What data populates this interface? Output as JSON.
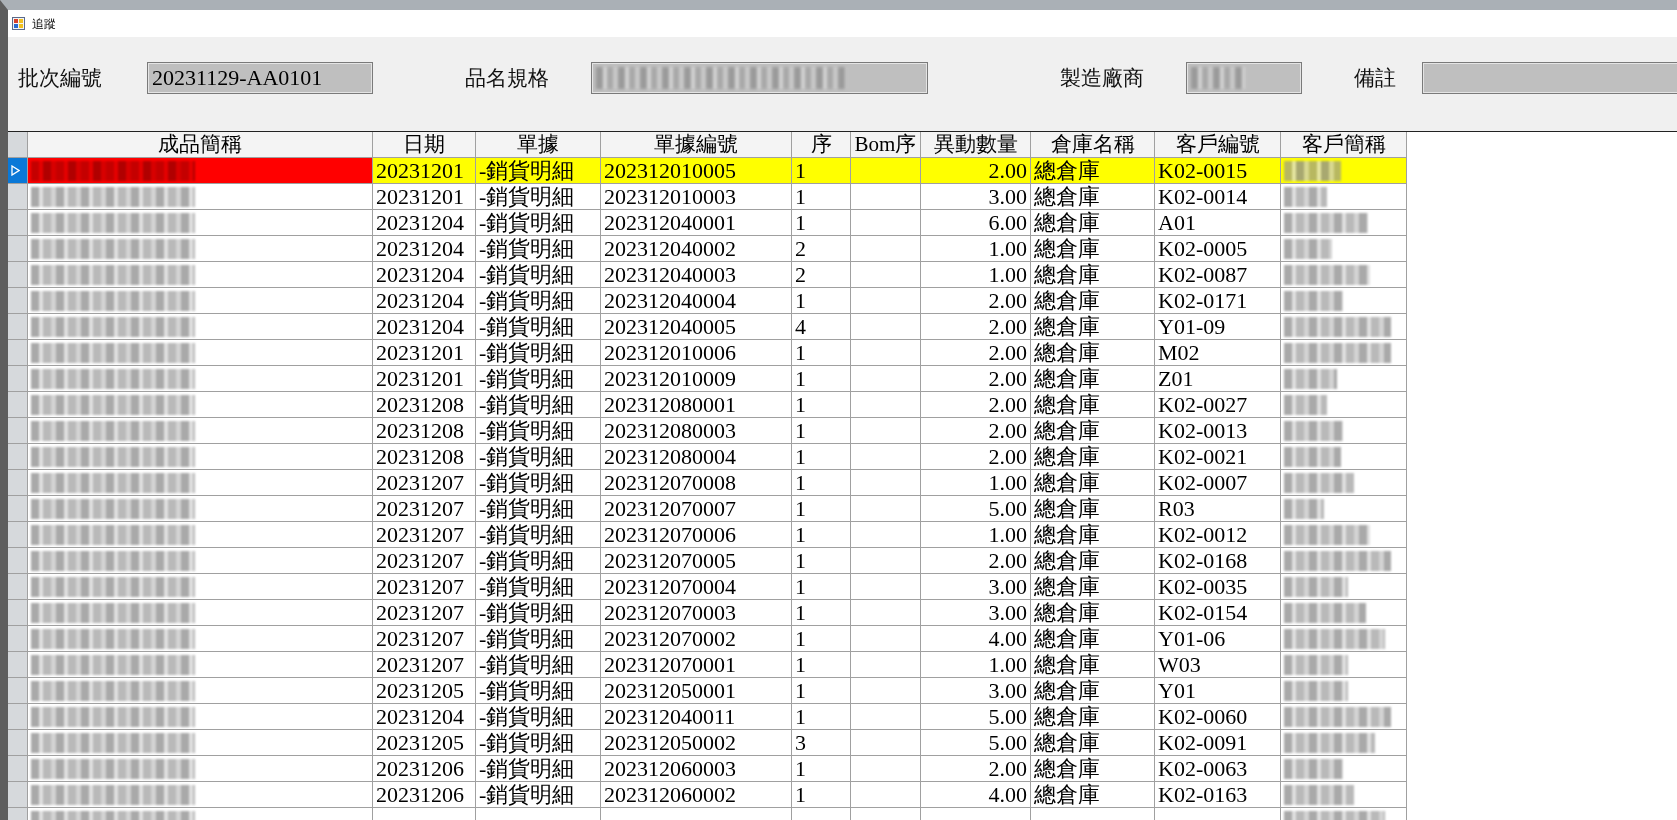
{
  "window": {
    "title": "追蹤"
  },
  "fields": [
    {
      "label": "批次編號",
      "value": "20231129-AA0101",
      "blurred": false
    },
    {
      "label": "品名規格",
      "blurred": true
    },
    {
      "label": "製造廠商",
      "blurred": true
    },
    {
      "label": "備註",
      "blurred": false
    }
  ],
  "table": {
    "columns": [
      {
        "label": "成品簡稱",
        "kind": "blurred"
      },
      {
        "label": "日期",
        "kind": "text"
      },
      {
        "label": "單據",
        "kind": "text"
      },
      {
        "label": "單據編號",
        "kind": "text"
      },
      {
        "label": "序",
        "kind": "text"
      },
      {
        "label": "Bom序",
        "kind": "empty"
      },
      {
        "label": "異動數量",
        "kind": "number"
      },
      {
        "label": "倉庫名稱",
        "kind": "text"
      },
      {
        "label": "客戶編號",
        "kind": "text"
      },
      {
        "label": "客戶簡稱",
        "kind": "blurred"
      }
    ],
    "rows": [
      {
        "selected": true,
        "cells": [
          "",
          "20231201",
          "-銷貨明細",
          "202312010005",
          "1",
          "",
          "2.00",
          "總倉庫",
          "K02-0015",
          ""
        ]
      },
      {
        "selected": false,
        "cells": [
          "",
          "20231201",
          "-銷貨明細",
          "202312010003",
          "1",
          "",
          "3.00",
          "總倉庫",
          "K02-0014",
          ""
        ]
      },
      {
        "selected": false,
        "cells": [
          "",
          "20231204",
          "-銷貨明細",
          "202312040001",
          "1",
          "",
          "6.00",
          "總倉庫",
          "A01",
          ""
        ]
      },
      {
        "selected": false,
        "cells": [
          "",
          "20231204",
          "-銷貨明細",
          "202312040002",
          "2",
          "",
          "1.00",
          "總倉庫",
          "K02-0005",
          ""
        ]
      },
      {
        "selected": false,
        "cells": [
          "",
          "20231204",
          "-銷貨明細",
          "202312040003",
          "2",
          "",
          "1.00",
          "總倉庫",
          "K02-0087",
          ""
        ]
      },
      {
        "selected": false,
        "cells": [
          "",
          "20231204",
          "-銷貨明細",
          "202312040004",
          "1",
          "",
          "2.00",
          "總倉庫",
          "K02-0171",
          ""
        ]
      },
      {
        "selected": false,
        "cells": [
          "",
          "20231204",
          "-銷貨明細",
          "202312040005",
          "4",
          "",
          "2.00",
          "總倉庫",
          "Y01-09",
          ""
        ]
      },
      {
        "selected": false,
        "cells": [
          "",
          "20231201",
          "-銷貨明細",
          "202312010006",
          "1",
          "",
          "2.00",
          "總倉庫",
          "M02",
          ""
        ]
      },
      {
        "selected": false,
        "cells": [
          "",
          "20231201",
          "-銷貨明細",
          "202312010009",
          "1",
          "",
          "2.00",
          "總倉庫",
          "Z01",
          ""
        ]
      },
      {
        "selected": false,
        "cells": [
          "",
          "20231208",
          "-銷貨明細",
          "202312080001",
          "1",
          "",
          "2.00",
          "總倉庫",
          "K02-0027",
          ""
        ]
      },
      {
        "selected": false,
        "cells": [
          "",
          "20231208",
          "-銷貨明細",
          "202312080003",
          "1",
          "",
          "2.00",
          "總倉庫",
          "K02-0013",
          ""
        ]
      },
      {
        "selected": false,
        "cells": [
          "",
          "20231208",
          "-銷貨明細",
          "202312080004",
          "1",
          "",
          "2.00",
          "總倉庫",
          "K02-0021",
          ""
        ]
      },
      {
        "selected": false,
        "cells": [
          "",
          "20231207",
          "-銷貨明細",
          "202312070008",
          "1",
          "",
          "1.00",
          "總倉庫",
          "K02-0007",
          ""
        ]
      },
      {
        "selected": false,
        "cells": [
          "",
          "20231207",
          "-銷貨明細",
          "202312070007",
          "1",
          "",
          "5.00",
          "總倉庫",
          "R03",
          ""
        ]
      },
      {
        "selected": false,
        "cells": [
          "",
          "20231207",
          "-銷貨明細",
          "202312070006",
          "1",
          "",
          "1.00",
          "總倉庫",
          "K02-0012",
          ""
        ]
      },
      {
        "selected": false,
        "cells": [
          "",
          "20231207",
          "-銷貨明細",
          "202312070005",
          "1",
          "",
          "2.00",
          "總倉庫",
          "K02-0168",
          ""
        ]
      },
      {
        "selected": false,
        "cells": [
          "",
          "20231207",
          "-銷貨明細",
          "202312070004",
          "1",
          "",
          "3.00",
          "總倉庫",
          "K02-0035",
          ""
        ]
      },
      {
        "selected": false,
        "cells": [
          "",
          "20231207",
          "-銷貨明細",
          "202312070003",
          "1",
          "",
          "3.00",
          "總倉庫",
          "K02-0154",
          ""
        ]
      },
      {
        "selected": false,
        "cells": [
          "",
          "20231207",
          "-銷貨明細",
          "202312070002",
          "1",
          "",
          "4.00",
          "總倉庫",
          "Y01-06",
          ""
        ]
      },
      {
        "selected": false,
        "cells": [
          "",
          "20231207",
          "-銷貨明細",
          "202312070001",
          "1",
          "",
          "1.00",
          "總倉庫",
          "W03",
          ""
        ]
      },
      {
        "selected": false,
        "cells": [
          "",
          "20231205",
          "-銷貨明細",
          "202312050001",
          "1",
          "",
          "3.00",
          "總倉庫",
          "Y01",
          ""
        ]
      },
      {
        "selected": false,
        "cells": [
          "",
          "20231204",
          "-銷貨明細",
          "202312040011",
          "1",
          "",
          "5.00",
          "總倉庫",
          "K02-0060",
          ""
        ]
      },
      {
        "selected": false,
        "cells": [
          "",
          "20231205",
          "-銷貨明細",
          "202312050002",
          "3",
          "",
          "5.00",
          "總倉庫",
          "K02-0091",
          ""
        ]
      },
      {
        "selected": false,
        "cells": [
          "",
          "20231206",
          "-銷貨明細",
          "202312060003",
          "1",
          "",
          "2.00",
          "總倉庫",
          "K02-0063",
          ""
        ]
      },
      {
        "selected": false,
        "cells": [
          "",
          "20231206",
          "-銷貨明細",
          "202312060002",
          "1",
          "",
          "4.00",
          "總倉庫",
          "K02-0163",
          ""
        ]
      }
    ]
  }
}
